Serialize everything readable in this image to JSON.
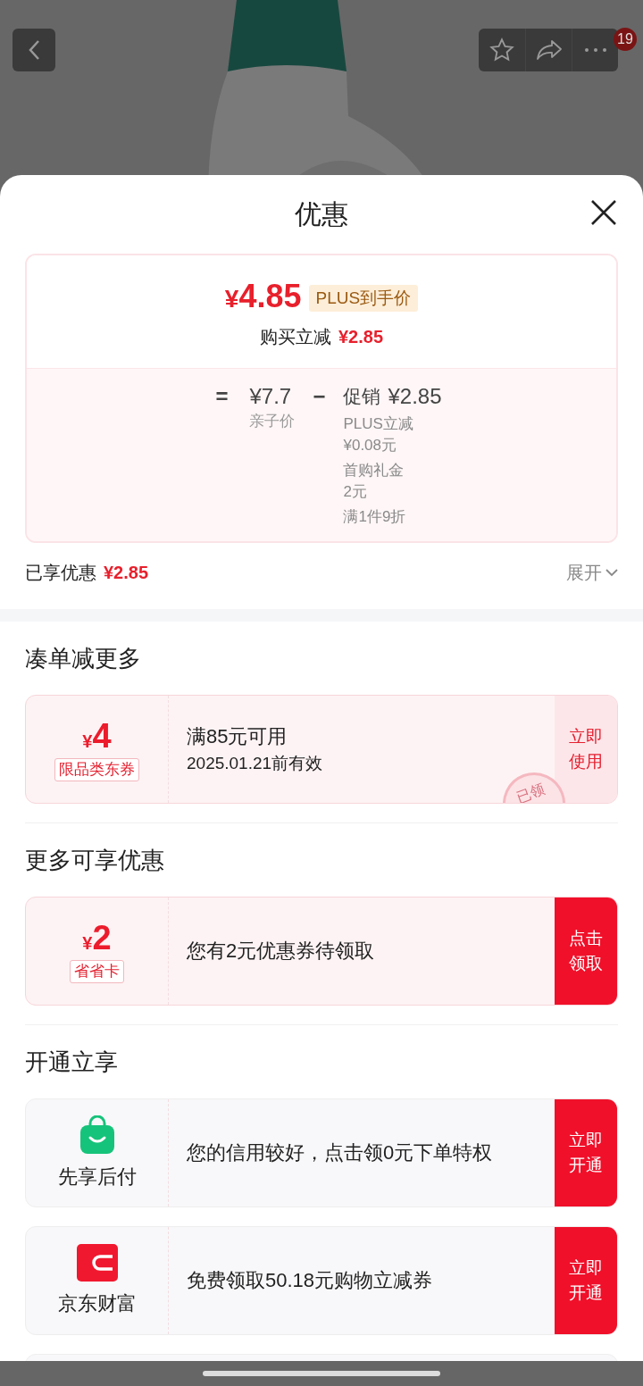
{
  "top_bar": {
    "badge": "19"
  },
  "sheet": {
    "title": "优惠"
  },
  "price_card": {
    "currency": "¥",
    "final_price": "4.85",
    "price_tag": "PLUS到手价",
    "reduce_label": "购买立减",
    "reduce_amount": "¥2.85",
    "equation": {
      "equals": "=",
      "base_price": "¥7.7",
      "base_label": "亲子价",
      "minus": "−",
      "promo_label": "促销",
      "promo_amount": "¥2.85",
      "details": [
        {
          "name": "PLUS立减",
          "amount": "¥0.08元"
        },
        {
          "name": "首购礼金",
          "amount": "2元"
        },
        {
          "name": "满1件9折"
        }
      ]
    }
  },
  "enjoyed": {
    "label": "已享优惠",
    "amount": "¥2.85",
    "expand": "展开"
  },
  "sections": [
    {
      "title": "凑单减更多",
      "cards": [
        {
          "kind": "coupon",
          "currency": "¥",
          "amount": "4",
          "tag": "限品类东券",
          "title": "满85元可用",
          "subtitle": "2025.01.21前有效",
          "stamp": "已领",
          "action": {
            "label": "立即使用",
            "solid": false
          }
        }
      ]
    },
    {
      "title": "更多可享优惠",
      "cards": [
        {
          "kind": "coupon",
          "currency": "¥",
          "amount": "2",
          "tag": "省省卡",
          "title": "您有2元优惠券待领取",
          "action": {
            "label": "点击领取",
            "solid": true
          }
        }
      ]
    },
    {
      "title": "开通立享",
      "cards": [
        {
          "kind": "service",
          "name": "先享后付",
          "title": "您的信用较好，点击领0元下单特权",
          "action": {
            "label": "立即开通",
            "solid": true
          }
        },
        {
          "kind": "service",
          "name": "京东财富",
          "title": "免费领取50.18元购物立减券",
          "action": {
            "label": "立即开通",
            "solid": true
          }
        },
        {
          "kind": "partial"
        }
      ]
    }
  ]
}
